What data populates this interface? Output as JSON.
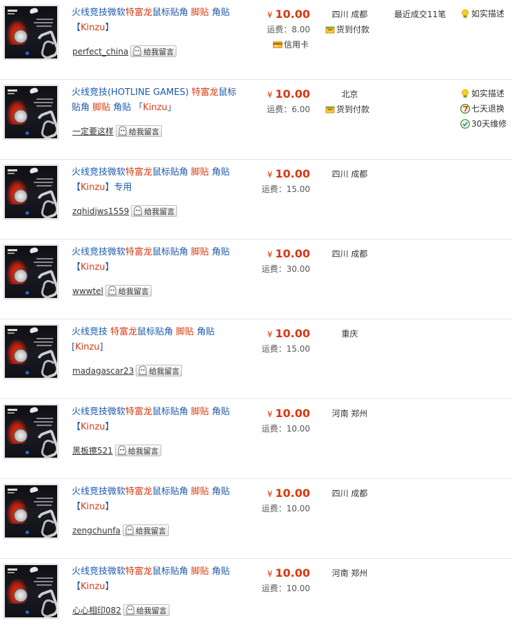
{
  "message_button_label": "给我留言",
  "listings": [
    {
      "title_parts": [
        {
          "text": "火线竞技微软",
          "hl": false
        },
        {
          "text": "特富龙",
          "hl": true
        },
        {
          "text": "鼠标贴角 ",
          "hl": false
        },
        {
          "text": "脚贴",
          "hl": true
        },
        {
          "text": " 角贴 【",
          "hl": false
        },
        {
          "text": "Kinzu",
          "hl": true
        },
        {
          "text": "】",
          "hl": false
        }
      ],
      "seller": "perfect_china",
      "currency": "¥",
      "price": "10.00",
      "shipping": "运费：8.00",
      "cod": "货到付款",
      "credit_card": "信用卡",
      "location": "四川 成都",
      "recent_sales": "最近成交11笔",
      "services": [
        "如实描述"
      ]
    },
    {
      "title_parts": [
        {
          "text": "火线竞技(HOTLINE GAMES) ",
          "hl": false
        },
        {
          "text": "特富龙",
          "hl": true
        },
        {
          "text": "鼠标贴角 ",
          "hl": false
        },
        {
          "text": "脚贴",
          "hl": true
        },
        {
          "text": " 角贴 「",
          "hl": false
        },
        {
          "text": "Kinzu",
          "hl": true
        },
        {
          "text": "」",
          "hl": false
        }
      ],
      "seller": "一定要这样",
      "currency": "¥",
      "price": "10.00",
      "shipping": "运费：6.00",
      "cod": "货到付款",
      "credit_card": "",
      "location": "北京",
      "recent_sales": "",
      "services": [
        "如实描述",
        "七天退换",
        "30天维修"
      ]
    },
    {
      "title_parts": [
        {
          "text": "火线竞技微软",
          "hl": false
        },
        {
          "text": "特富龙",
          "hl": true
        },
        {
          "text": "鼠标贴角 ",
          "hl": false
        },
        {
          "text": "脚贴",
          "hl": true
        },
        {
          "text": " 角贴 【",
          "hl": false
        },
        {
          "text": "Kinzu",
          "hl": true
        },
        {
          "text": "】专用",
          "hl": false
        }
      ],
      "seller": "zqhidjws1559",
      "currency": "¥",
      "price": "10.00",
      "shipping": "运费：15.00",
      "cod": "",
      "credit_card": "",
      "location": "四川 成都",
      "recent_sales": "",
      "services": []
    },
    {
      "title_parts": [
        {
          "text": "火线竞技微软",
          "hl": false
        },
        {
          "text": "特富龙",
          "hl": true
        },
        {
          "text": "鼠标贴角 ",
          "hl": false
        },
        {
          "text": "脚贴",
          "hl": true
        },
        {
          "text": " 角贴 【",
          "hl": false
        },
        {
          "text": "Kinzu",
          "hl": true
        },
        {
          "text": "】",
          "hl": false
        }
      ],
      "seller": "wwwtel",
      "currency": "¥",
      "price": "10.00",
      "shipping": "运费：30.00",
      "cod": "",
      "credit_card": "",
      "location": "四川 成都",
      "recent_sales": "",
      "services": []
    },
    {
      "title_parts": [
        {
          "text": "火线竞技 ",
          "hl": false
        },
        {
          "text": "特富龙",
          "hl": true
        },
        {
          "text": "鼠标贴角 ",
          "hl": false
        },
        {
          "text": "脚贴",
          "hl": true
        },
        {
          "text": " 角贴 [",
          "hl": false
        },
        {
          "text": "Kinzu",
          "hl": true
        },
        {
          "text": "]",
          "hl": false
        }
      ],
      "seller": "madagascar23",
      "currency": "¥",
      "price": "10.00",
      "shipping": "运费：15.00",
      "cod": "",
      "credit_card": "",
      "location": "重庆",
      "recent_sales": "",
      "services": []
    },
    {
      "title_parts": [
        {
          "text": "火线竞技微软",
          "hl": false
        },
        {
          "text": "特富龙",
          "hl": true
        },
        {
          "text": "鼠标贴角 ",
          "hl": false
        },
        {
          "text": "脚贴",
          "hl": true
        },
        {
          "text": " 角贴 【",
          "hl": false
        },
        {
          "text": "Kinzu",
          "hl": true
        },
        {
          "text": "】",
          "hl": false
        }
      ],
      "seller": "黑板擦521",
      "currency": "¥",
      "price": "10.00",
      "shipping": "运费：10.00",
      "cod": "",
      "credit_card": "",
      "location": "河南 郑州",
      "recent_sales": "",
      "services": []
    },
    {
      "title_parts": [
        {
          "text": "火线竞技微软",
          "hl": false
        },
        {
          "text": "特富龙",
          "hl": true
        },
        {
          "text": "鼠标贴角 ",
          "hl": false
        },
        {
          "text": "脚贴",
          "hl": true
        },
        {
          "text": " 角贴 【",
          "hl": false
        },
        {
          "text": "Kinzu",
          "hl": true
        },
        {
          "text": "】",
          "hl": false
        }
      ],
      "seller": "zengchunfa",
      "currency": "¥",
      "price": "10.00",
      "shipping": "运费：10.00",
      "cod": "",
      "credit_card": "",
      "location": "四川 成都",
      "recent_sales": "",
      "services": []
    },
    {
      "title_parts": [
        {
          "text": "火线竞技微软",
          "hl": false
        },
        {
          "text": "特富龙",
          "hl": true
        },
        {
          "text": "鼠标贴角 ",
          "hl": false
        },
        {
          "text": "脚贴",
          "hl": true
        },
        {
          "text": " 角贴 【",
          "hl": false
        },
        {
          "text": "Kinzu",
          "hl": true
        },
        {
          "text": "】",
          "hl": false
        }
      ],
      "seller": "心心相印082",
      "currency": "¥",
      "price": "10.00",
      "shipping": "运费：10.00",
      "cod": "",
      "credit_card": "",
      "location": "河南 郑州",
      "recent_sales": "",
      "services": []
    }
  ],
  "service_icons": {
    "如实描述": "lightbulb-icon",
    "七天退换": "seven-day-return-icon",
    "30天维修": "repair-30-icon"
  },
  "colors": {
    "title_link": "#1a58a8",
    "highlight": "#d8380f",
    "price": "#d8380f"
  }
}
